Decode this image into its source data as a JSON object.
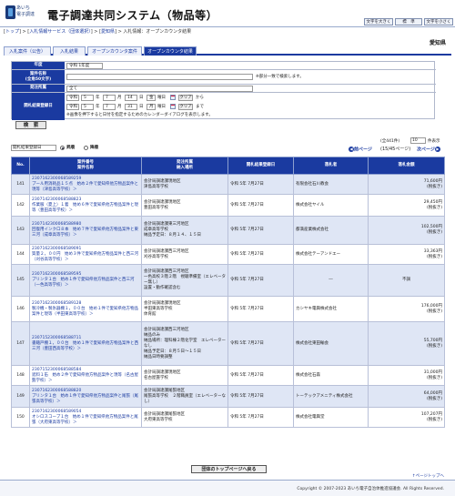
{
  "header": {
    "logo_line1": "あいち",
    "logo_line2": "電子調達",
    "title": "電子調達共同システム（物品等）",
    "btn_large": "文字を大きく",
    "btn_std": "標　準",
    "btn_small": "文字を小さく"
  },
  "breadcrumb": {
    "top": "トップ",
    "item1": "入札情報サービス（団体選択）",
    "item2": "愛知県",
    "current": "入札情報：オープンカウンタ結果"
  },
  "prefecture": "愛知県",
  "tabs": [
    "入札案件（公告）",
    "入札結果",
    "オープンカウンタ案件",
    "オープンカウンタ結果"
  ],
  "search": {
    "year_label": "年度",
    "year_value": "令和 1年度",
    "case_label": "案件名称\n(全角50文字)",
    "case_value": "",
    "case_note": "※部分一致で検索します。",
    "dept_label": "発注所属",
    "dept_value": "全て",
    "date_label": "開札結果登録日",
    "from_era": "令和",
    "from_year": "5",
    "from_month": "7",
    "from_day": "14",
    "from_weekday": "金",
    "to_era": "令和",
    "to_year": "5",
    "to_month": "7",
    "to_day": "31",
    "to_weekday": "月",
    "u_year": "年",
    "u_month": "月",
    "u_day": "日",
    "u_yobi": "曜日",
    "clear_label": "クリア",
    "from_suffix": "から",
    "to_suffix": "まで",
    "cal_note": "※画像を押下すると日付を指定するためのカレンダーダイアログを表示します。"
  },
  "search_button": "検　索",
  "sort": {
    "select_value": "開札結果登録日",
    "asc": "昇順",
    "desc": "降順"
  },
  "paging": {
    "count": "(全441件)",
    "per_page_value": "10",
    "per_page_label": "件表示",
    "prev": "前ページ",
    "range": "(15/45ページ)",
    "next": "次ページ"
  },
  "table": {
    "headers": [
      "No.",
      "案件番号\n案件名称",
      "発注所属\n納入場所",
      "開札結果登録日",
      "落札者",
      "落札金額"
    ],
    "rows": [
      {
        "no": "141",
        "num": "2307162300068589259",
        "name": "プール用消耗品１５点　始め２件で愛知県他方物品案件と現等（津島高等学校）＞",
        "dept": "会計局調達課現地区\n津島高等学校",
        "date": "令和 5年  7月27日",
        "winner": "有限会社石川教会",
        "amount": "71,600円\n(税抜き)"
      },
      {
        "no": "142",
        "num": "2307142300068588823",
        "name": "作業服（夏上）１着　始め６件で愛知県他方物品案件と現等（豊田高等学校）＞",
        "dept": "会計局調達課現地区\n豊田高等学校",
        "date": "令和 5年  7月27日",
        "winner": "株式会社ヤイル",
        "amount": "29,450円\n(税抜き)"
      },
      {
        "no": "143",
        "num": "2307142300068588980",
        "name": "回復用インクロ８本　始め７件で愛知県他方物品案件と東三河（成章高等学校）＞",
        "dept": "会計局調達課東三河地区\n成章高等学校\n納品予定日：８月１４、１５日",
        "date": "令和 5年  7月27日",
        "winner": "都満産業株式会社",
        "amount": "102,500円\n(税抜き)"
      },
      {
        "no": "144",
        "num": "2307162300068589091",
        "name": "質量２，００円　始め３件で愛知県他方物品案件と西三河（刈谷高等学校）＞",
        "dept": "会計局調達課西三河地区\n刈谷高等学校",
        "date": "令和 5年  7月27日",
        "winner": "株式会社テーアンドエー",
        "amount": "33,363円\n(税抜き)"
      },
      {
        "no": "145",
        "num": "2307162300068589595",
        "name": "プリンタ１台　始め１件で愛知県他方物品案件と西三河（一色高等学校）＞",
        "dept": "会計局調達課西三河地区\n一色高校３階２階　視聴準備室（エレベーター無し）\n設置・動作確認含む",
        "date": "令和 5年  7月27日",
        "winner": "―",
        "amount": "不調"
      },
      {
        "no": "146",
        "num": "2307162300068589128",
        "name": "製冷機・製氷器棚１，００台　始め１件で愛知県他方物品案件と現等（半田東高等学校）＞",
        "dept": "会計局調達課現地区\n半田東高等学校\n体育館",
        "date": "令和 5年  7月27日",
        "winner": "カシヤキ電興株式会社",
        "amount": "176,000円\n(税抜き)"
      },
      {
        "no": "147",
        "num": "2307152300068588711",
        "name": "書籍戸棚１，００台　始め１件で愛知県他方物品案件と西三河（豊田西高等学校）＞",
        "dept": "会計局調達課西三河地区\n納品のみ\n納品場所：理科棟２階化学室　エレベーターなし\n納品予定日：８月５日〜１５日\n納品日時要調整",
        "date": "令和 5年  7月27日",
        "winner": "株式会社東田輸会",
        "amount": "55,700円\n(税抜き)"
      },
      {
        "no": "148",
        "num": "2307152300068588584",
        "name": "遮料１缶　始め２件で愛知県他方物品案件と現等（名古屋聾学校）＞",
        "dept": "会計局調達課現地区\n名古屋聾学校",
        "date": "令和 5年  7月27日",
        "winner": "株式会社石森",
        "amount": "31,000円\n(税抜き)"
      },
      {
        "no": "149",
        "num": "2307162300068588820",
        "name": "プリンタ１台　始め１件で愛知県他方物品案件と尾張（尾張高等学校）＞",
        "dept": "会計局調達課尾張地区\n尾張高等学校　２階職員室（エレベーターなし）",
        "date": "令和 5年  7月27日",
        "winner": "トーテックアメニティ株式会社",
        "amount": "64,000円\n(税抜き)"
      },
      {
        "no": "150",
        "num": "2307162300068589054",
        "name": "オシロスコープ１台　始め１件で愛知県他方物品案件と尾張（大府東高等学校）＞",
        "dept": "会計局調達課尾張地区\n大府東高等学校",
        "date": "令和 5年  7月27日",
        "winner": "株式会社電興堂",
        "amount": "107,207円\n(税抜き)"
      }
    ]
  },
  "back_button": "団体のトップページへ戻る",
  "page_top": "↑ページトップへ",
  "copyright": "Copyright © 2007-2023 あいち電子自治体推進協議会. All Rights Reserved."
}
